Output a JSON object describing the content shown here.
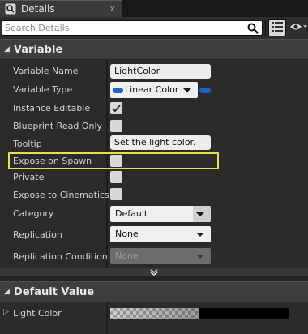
{
  "tab": {
    "title": "Details",
    "close_glyph": "x",
    "icon": "details-magnifier-icon"
  },
  "search": {
    "placeholder": "Search Details",
    "search_icon": "search-icon",
    "view_options_icon": "grid-view-icon",
    "eye_icon": "eye-visibility-icon"
  },
  "variable_section": {
    "title": "Variable",
    "rows": {
      "variable_name": {
        "label": "Variable Name",
        "value": "LightColor"
      },
      "variable_type": {
        "label": "Variable Type",
        "value": "Linear Color",
        "pin_color": "#1e63c8"
      },
      "instance_editable": {
        "label": "Instance Editable",
        "checked": true
      },
      "blueprint_read_only": {
        "label": "Blueprint Read Only",
        "checked": false
      },
      "tooltip": {
        "label": "Tooltip",
        "value": "Set the light color."
      },
      "expose_on_spawn": {
        "label": "Expose on Spawn",
        "checked": false,
        "highlighted": true
      },
      "private": {
        "label": "Private",
        "checked": false
      },
      "expose_to_cinematics": {
        "label": "Expose to Cinematics",
        "checked": false
      },
      "category": {
        "label": "Category",
        "value": "Default"
      },
      "replication": {
        "label": "Replication",
        "value": "None"
      },
      "replication_condition": {
        "label": "Replication Condition",
        "value": "None",
        "disabled": true
      }
    }
  },
  "default_section": {
    "title": "Default Value",
    "rows": {
      "light_color": {
        "label": "Light Color",
        "value_color": "#000000"
      }
    }
  },
  "colors": {
    "highlight": "#e6e14a",
    "pin_blue": "#1e63c8"
  }
}
